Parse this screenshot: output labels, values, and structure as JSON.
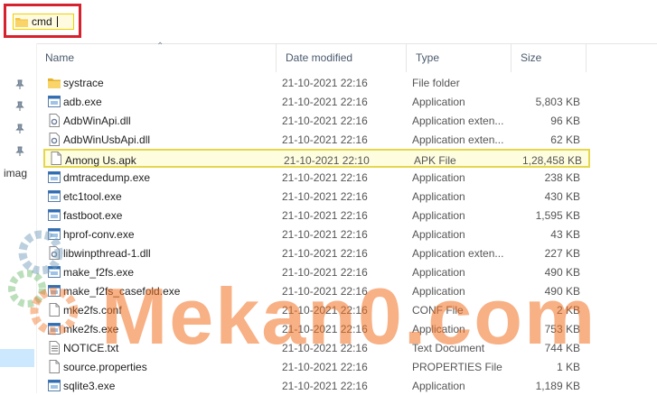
{
  "address_bar": {
    "value": "cmd"
  },
  "nav": {
    "partial_label": "imag"
  },
  "columns": {
    "name": "Name",
    "date": "Date modified",
    "type": "Type",
    "size": "Size"
  },
  "files": [
    {
      "name": "systrace",
      "date": "21-10-2021 22:16",
      "type": "File folder",
      "size": "",
      "icon": "folder-icon"
    },
    {
      "name": "adb.exe",
      "date": "21-10-2021 22:16",
      "type": "Application",
      "size": "5,803 KB",
      "icon": "exe-icon"
    },
    {
      "name": "AdbWinApi.dll",
      "date": "21-10-2021 22:16",
      "type": "Application exten...",
      "size": "96 KB",
      "icon": "dll-icon"
    },
    {
      "name": "AdbWinUsbApi.dll",
      "date": "21-10-2021 22:16",
      "type": "Application exten...",
      "size": "62 KB",
      "icon": "dll-icon"
    },
    {
      "name": "Among Us.apk",
      "date": "21-10-2021 22:10",
      "type": "APK File",
      "size": "1,28,458 KB",
      "icon": "file-icon",
      "highlight": true
    },
    {
      "name": "dmtracedump.exe",
      "date": "21-10-2021 22:16",
      "type": "Application",
      "size": "238 KB",
      "icon": "exe-icon"
    },
    {
      "name": "etc1tool.exe",
      "date": "21-10-2021 22:16",
      "type": "Application",
      "size": "430 KB",
      "icon": "exe-icon"
    },
    {
      "name": "fastboot.exe",
      "date": "21-10-2021 22:16",
      "type": "Application",
      "size": "1,595 KB",
      "icon": "exe-icon"
    },
    {
      "name": "hprof-conv.exe",
      "date": "21-10-2021 22:16",
      "type": "Application",
      "size": "43 KB",
      "icon": "exe-icon"
    },
    {
      "name": "libwinpthread-1.dll",
      "date": "21-10-2021 22:16",
      "type": "Application exten...",
      "size": "227 KB",
      "icon": "dll-icon"
    },
    {
      "name": "make_f2fs.exe",
      "date": "21-10-2021 22:16",
      "type": "Application",
      "size": "490 KB",
      "icon": "exe-icon"
    },
    {
      "name": "make_f2fs_casefold.exe",
      "date": "21-10-2021 22:16",
      "type": "Application",
      "size": "490 KB",
      "icon": "exe-icon"
    },
    {
      "name": "mke2fs.conf",
      "date": "21-10-2021 22:16",
      "type": "CONF File",
      "size": "2 KB",
      "icon": "file-icon"
    },
    {
      "name": "mke2fs.exe",
      "date": "21-10-2021 22:16",
      "type": "Application",
      "size": "753 KB",
      "icon": "exe-icon"
    },
    {
      "name": "NOTICE.txt",
      "date": "21-10-2021 22:16",
      "type": "Text Document",
      "size": "744 KB",
      "icon": "text-icon"
    },
    {
      "name": "source.properties",
      "date": "21-10-2021 22:16",
      "type": "PROPERTIES File",
      "size": "1 KB",
      "icon": "file-icon"
    },
    {
      "name": "sqlite3.exe",
      "date": "21-10-2021 22:16",
      "type": "Application",
      "size": "1,189 KB",
      "icon": "exe-icon"
    }
  ],
  "watermark": {
    "text": "Mekan0.com"
  },
  "colors": {
    "highlight_border": "#e4d64e",
    "address_box_border": "#d6222d",
    "folder": "#f5c342",
    "watermark": "#f37021"
  }
}
